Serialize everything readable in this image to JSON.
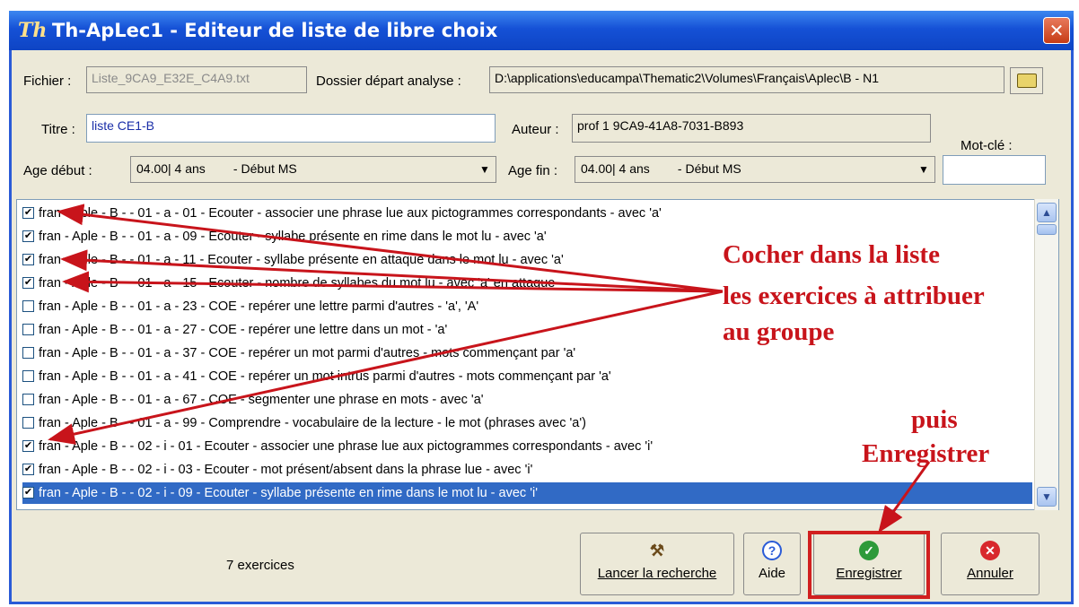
{
  "window": {
    "title": "Th-ApLec1 - Editeur de liste de libre choix",
    "app_icon": "Th",
    "close_label": "✕"
  },
  "form": {
    "fichier_label": "Fichier :",
    "fichier_value": "Liste_9CA9_E32E_C4A9.txt",
    "dossier_label": "Dossier départ analyse :",
    "dossier_value": "D:\\applications\\educampa\\Thematic2\\Volumes\\Français\\Aplec\\B - N1",
    "titre_label": "Titre :",
    "titre_value": "liste CE1-B",
    "auteur_label": "Auteur :",
    "auteur_value": "prof 1 9CA9-41A8-7031-B893",
    "motcle_label": "Mot-clé :",
    "motcle_value": "",
    "age_debut_label": "Age début :",
    "age_debut_value": "04.00| 4 ans        - Début MS",
    "age_fin_label": "Age fin :",
    "age_fin_value": "04.00| 4 ans        - Début MS"
  },
  "exercises": [
    {
      "checked": true,
      "selected": false,
      "text": "fran - Aple - B -  - 01 - a - 01 - Ecouter - associer une phrase lue aux pictogrammes correspondants - avec 'a'"
    },
    {
      "checked": true,
      "selected": false,
      "text": "fran - Aple - B -  - 01 - a - 09 - Ecouter - syllabe présente en rime dans le mot lu - avec 'a'"
    },
    {
      "checked": true,
      "selected": false,
      "text": "fran - Aple - B -  - 01 - a - 11 - Ecouter - syllabe présente en attaque dans le mot lu - avec 'a'"
    },
    {
      "checked": true,
      "selected": false,
      "text": "fran - Aple - B -  - 01 - a - 15 - Ecouter - nombre de syllabes du mot lu - avec 'a' en attaque"
    },
    {
      "checked": false,
      "selected": false,
      "text": "fran - Aple - B -  - 01 - a - 23 - COE - repérer une lettre parmi d'autres - 'a', 'A'"
    },
    {
      "checked": false,
      "selected": false,
      "text": "fran - Aple - B -  - 01 - a - 27 - COE - repérer une lettre dans un mot - 'a'"
    },
    {
      "checked": false,
      "selected": false,
      "text": "fran - Aple - B -  - 01 - a - 37 - COE - repérer un mot parmi d'autres - mots commençant par 'a'"
    },
    {
      "checked": false,
      "selected": false,
      "text": "fran - Aple - B -  - 01 - a - 41 - COE - repérer un mot intrus parmi d'autres - mots commençant par 'a'"
    },
    {
      "checked": false,
      "selected": false,
      "text": "fran - Aple - B -  - 01 - a - 67 - COE - segmenter une phrase en mots - avec 'a'"
    },
    {
      "checked": false,
      "selected": false,
      "text": "fran - Aple - B -  - 01 - a - 99 - Comprendre - vocabulaire de la lecture - le mot (phrases avec 'a')"
    },
    {
      "checked": true,
      "selected": false,
      "text": "fran - Aple - B -  - 02 - i - 01 - Ecouter - associer une phrase lue aux pictogrammes correspondants - avec 'i'"
    },
    {
      "checked": true,
      "selected": false,
      "text": "fran - Aple - B -  - 02 - i - 03 - Ecouter - mot présent/absent dans la phrase lue - avec 'i'"
    },
    {
      "checked": true,
      "selected": true,
      "text": "fran - Aple - B -  - 02 - i - 09 - Ecouter - syllabe présente en rime dans le mot lu - avec 'i'"
    }
  ],
  "footer": {
    "count_text": "7 exercices",
    "search_button": "Lancer la recherche",
    "help_button": "Aide",
    "save_button": "Enregistrer",
    "cancel_button": "Annuler"
  },
  "annotations": {
    "line1": "Cocher dans la liste",
    "line2": "les exercices à attribuer",
    "line3": "au groupe",
    "line4": "puis",
    "line5": "Enregistrer"
  },
  "colors": {
    "annotation_red": "#c8141b",
    "selection_blue": "#316ac5",
    "titlebar_blue": "#1551d6"
  }
}
